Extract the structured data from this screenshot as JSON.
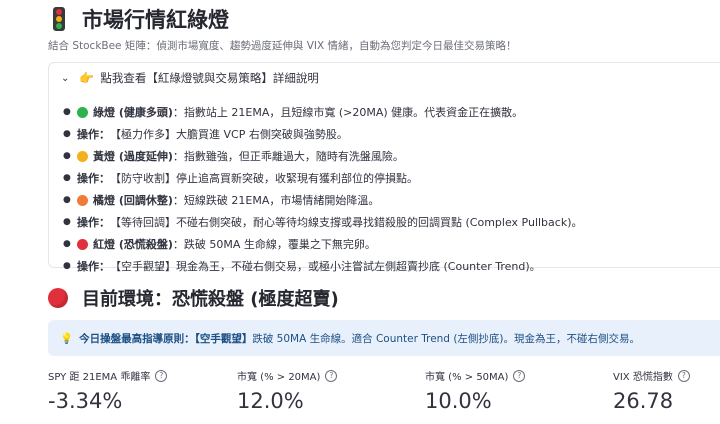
{
  "header": {
    "title_icon": "traffic-light-icon",
    "title": "市場行情紅綠燈",
    "subtitle": "結合 StockBee 矩陣：偵測市場寬度、趨勢過度延伸與 VIX 情緒，自動為您判定今日最佳交易策略！"
  },
  "expander": {
    "icon": "pointing-hand-icon",
    "label": "點我查看【紅綠燈號與交易策略】詳細說明",
    "rules": [
      {
        "dot_color": "#2eb34a",
        "bold": "綠燈 (健康多頭)",
        "text": "：指數站上 21EMA，且短線市寬 (>20MA) 健康。代表資金正在擴散。"
      },
      {
        "bold": "操作：",
        "text": "【極力作多】大膽買進 VCP 右側突破與強勢股。"
      },
      {
        "dot_color": "#f2b01e",
        "bold": "黃燈 (過度延伸)",
        "text": "：指數雖強，但正乖離過大，隨時有洗盤風險。"
      },
      {
        "bold": "操作：",
        "text": "【防守收割】停止追高買新突破，收緊現有獲利部位的停損點。"
      },
      {
        "dot_color": "#f07c3a",
        "bold": "橘燈 (回調休整)",
        "text": "：短線跌破 21EMA，市場情緒開始降溫。"
      },
      {
        "bold": "操作：",
        "text": "【等待回調】不碰右側突破，耐心等待均線支撐或尋找錯殺股的回調買點 (Complex Pullback)。"
      },
      {
        "dot_color": "#e0303c",
        "bold": "紅燈 (恐慌殺盤)",
        "text": "：跌破 50MA 生命線，覆巢之下無完卵。"
      },
      {
        "bold": "操作：",
        "text": "【空手觀望】現金為王，不碰右側交易，或極小注嘗試左側超賣抄底 (Counter Trend)。"
      }
    ]
  },
  "environment": {
    "dot_color": "#e0303c",
    "title": "目前環境：恐慌殺盤 (極度超賣)"
  },
  "alert": {
    "icon": "lightbulb-icon",
    "bold": "今日操盤最高指導原則：【空手觀望】",
    "text": " 跌破 50MA 生命線。適合 Counter Trend (左側抄底)。現金為王，不碰右側交易。"
  },
  "metrics": [
    {
      "label": "SPY 距 21EMA 乖離率",
      "value": "-3.34%"
    },
    {
      "label": "市寬 (% > 20MA)",
      "value": "12.0%"
    },
    {
      "label": "市寬 (% > 50MA)",
      "value": "10.0%"
    },
    {
      "label": "VIX 恐慌指數",
      "value": "26.78"
    }
  ]
}
